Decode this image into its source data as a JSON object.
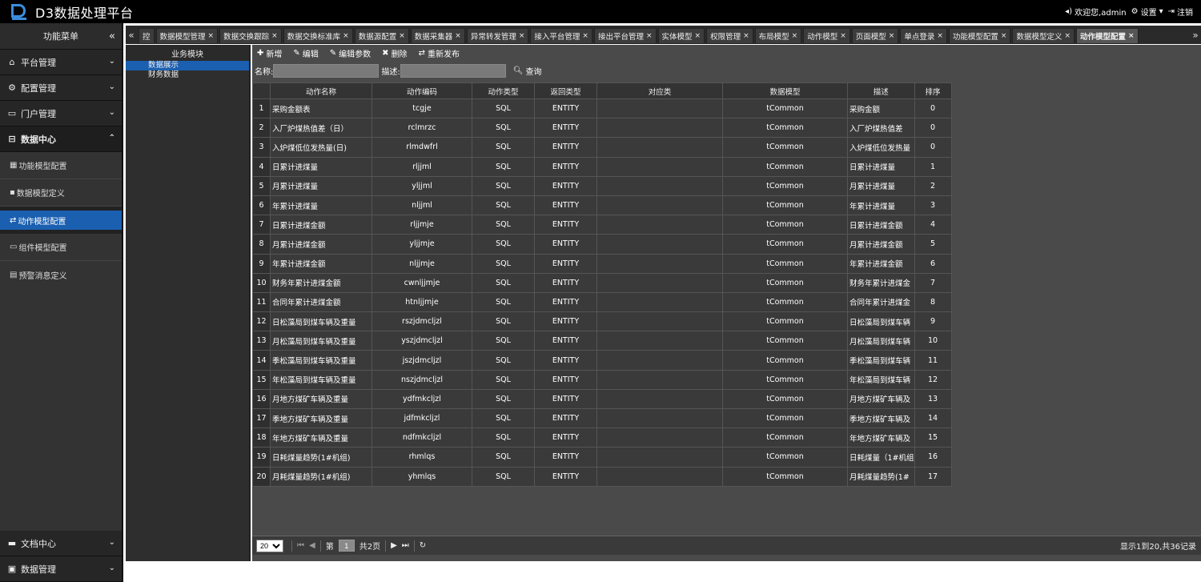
{
  "app": {
    "title": "D3数据处理平台"
  },
  "header": {
    "welcome": "欢迎您,admin",
    "settings": "设置",
    "logout": "注销"
  },
  "sidebar": {
    "title": "功能菜单",
    "groups": [
      {
        "label": "平台管理"
      },
      {
        "label": "配置管理"
      },
      {
        "label": "门户管理"
      },
      {
        "label": "数据中心"
      }
    ],
    "items": [
      {
        "label": "功能模型配置"
      },
      {
        "label": "数据模型定义"
      },
      {
        "label": "动作模型配置"
      },
      {
        "label": "组件模型配置"
      },
      {
        "label": "预警消息定义"
      }
    ],
    "bottom": [
      {
        "label": "文档中心"
      },
      {
        "label": "数据管理"
      }
    ]
  },
  "tabs": [
    {
      "label": "控"
    },
    {
      "label": "数据模型管理"
    },
    {
      "label": "数据交换跟踪"
    },
    {
      "label": "数据交换标准库"
    },
    {
      "label": "数据源配置"
    },
    {
      "label": "数据采集器"
    },
    {
      "label": "异常转发管理"
    },
    {
      "label": "接入平台管理"
    },
    {
      "label": "接出平台管理"
    },
    {
      "label": "实体模型"
    },
    {
      "label": "权限管理"
    },
    {
      "label": "布局模型"
    },
    {
      "label": "动作模型"
    },
    {
      "label": "页面模型"
    },
    {
      "label": "单点登录"
    },
    {
      "label": "功能模型配置"
    },
    {
      "label": "数据模型定义"
    },
    {
      "label": "动作模型配置"
    }
  ],
  "module_panel": {
    "title": "业务模块",
    "items": [
      {
        "label": "数据展示"
      },
      {
        "label": "财务数据"
      }
    ]
  },
  "toolbar": {
    "add": "新增",
    "edit": "编辑",
    "edit_params": "编辑参数",
    "delete": "删除",
    "republish": "重新发布"
  },
  "search": {
    "name_label": "名称:",
    "desc_label": "描述:",
    "query": "查询"
  },
  "table": {
    "columns": [
      "动作名称",
      "动作编码",
      "动作类型",
      "返回类型",
      "对应类",
      "数据模型",
      "描述",
      "排序"
    ],
    "rows": [
      [
        "1",
        "采购金额表",
        "tcgje",
        "SQL",
        "ENTITY",
        "",
        "tCommon",
        "采购金额",
        "0"
      ],
      [
        "2",
        "入厂炉煤热值差（日）",
        "rclmrzc",
        "SQL",
        "ENTITY",
        "",
        "tCommon",
        "入厂炉煤热值差",
        "0"
      ],
      [
        "3",
        "入炉煤低位发热量(日)",
        "rlmdwfrl",
        "SQL",
        "ENTITY",
        "",
        "tCommon",
        "入炉煤低位发热量",
        "0"
      ],
      [
        "4",
        "日累计进煤量",
        "rljjml",
        "SQL",
        "ENTITY",
        "",
        "tCommon",
        "日累计进煤量",
        "1"
      ],
      [
        "5",
        "月累计进煤量",
        "yljjml",
        "SQL",
        "ENTITY",
        "",
        "tCommon",
        "月累计进煤量",
        "2"
      ],
      [
        "6",
        "年累计进煤量",
        "nljjml",
        "SQL",
        "ENTITY",
        "",
        "tCommon",
        "年累计进煤量",
        "3"
      ],
      [
        "7",
        "日累计进煤金额",
        "rljjmje",
        "SQL",
        "ENTITY",
        "",
        "tCommon",
        "日累计进煤金额",
        "4"
      ],
      [
        "8",
        "月累计进煤金额",
        "yljjmje",
        "SQL",
        "ENTITY",
        "",
        "tCommon",
        "月累计进煤金额",
        "5"
      ],
      [
        "9",
        "年累计进煤金额",
        "nljjmje",
        "SQL",
        "ENTITY",
        "",
        "tCommon",
        "年累计进煤金额",
        "6"
      ],
      [
        "10",
        "财务年累计进煤金额",
        "cwnljjmje",
        "SQL",
        "ENTITY",
        "",
        "tCommon",
        "财务年累计进煤金",
        "7"
      ],
      [
        "11",
        "合同年累计进煤金额",
        "htnljjmje",
        "SQL",
        "ENTITY",
        "",
        "tCommon",
        "合同年累计进煤金",
        "8"
      ],
      [
        "12",
        "日松藻局到煤车辆及重量",
        "rszjdmcljzl",
        "SQL",
        "ENTITY",
        "",
        "tCommon",
        "日松藻局到煤车辆",
        "9"
      ],
      [
        "13",
        "月松藻局到煤车辆及重量",
        "yszjdmcljzl",
        "SQL",
        "ENTITY",
        "",
        "tCommon",
        "月松藻局到煤车辆",
        "10"
      ],
      [
        "14",
        "季松藻局到煤车辆及重量",
        "jszjdmcljzl",
        "SQL",
        "ENTITY",
        "",
        "tCommon",
        "季松藻局到煤车辆",
        "11"
      ],
      [
        "15",
        "年松藻局到煤车辆及重量",
        "nszjdmcljzl",
        "SQL",
        "ENTITY",
        "",
        "tCommon",
        "年松藻局到煤车辆",
        "12"
      ],
      [
        "16",
        "月地方煤矿车辆及重量",
        "ydfmkcljzl",
        "SQL",
        "ENTITY",
        "",
        "tCommon",
        "月地方煤矿车辆及",
        "13"
      ],
      [
        "17",
        "季地方煤矿车辆及重量",
        "jdfmkcljzl",
        "SQL",
        "ENTITY",
        "",
        "tCommon",
        "季地方煤矿车辆及",
        "14"
      ],
      [
        "18",
        "年地方煤矿车辆及重量",
        "ndfmkcljzl",
        "SQL",
        "ENTITY",
        "",
        "tCommon",
        "年地方煤矿车辆及",
        "15"
      ],
      [
        "19",
        "日耗煤量趋势(1#机组)",
        "rhmlqs",
        "SQL",
        "ENTITY",
        "",
        "tCommon",
        "日耗煤量（1#机组",
        "16"
      ],
      [
        "20",
        "月耗煤量趋势(1#机组)",
        "yhmlqs",
        "SQL",
        "ENTITY",
        "",
        "tCommon",
        "月耗煤量趋势(1#",
        "17"
      ]
    ]
  },
  "pager": {
    "page_size": "20",
    "page_prefix": "第",
    "page_value": "1",
    "page_suffix": "共2页",
    "info": "显示1到20,共36记录"
  }
}
